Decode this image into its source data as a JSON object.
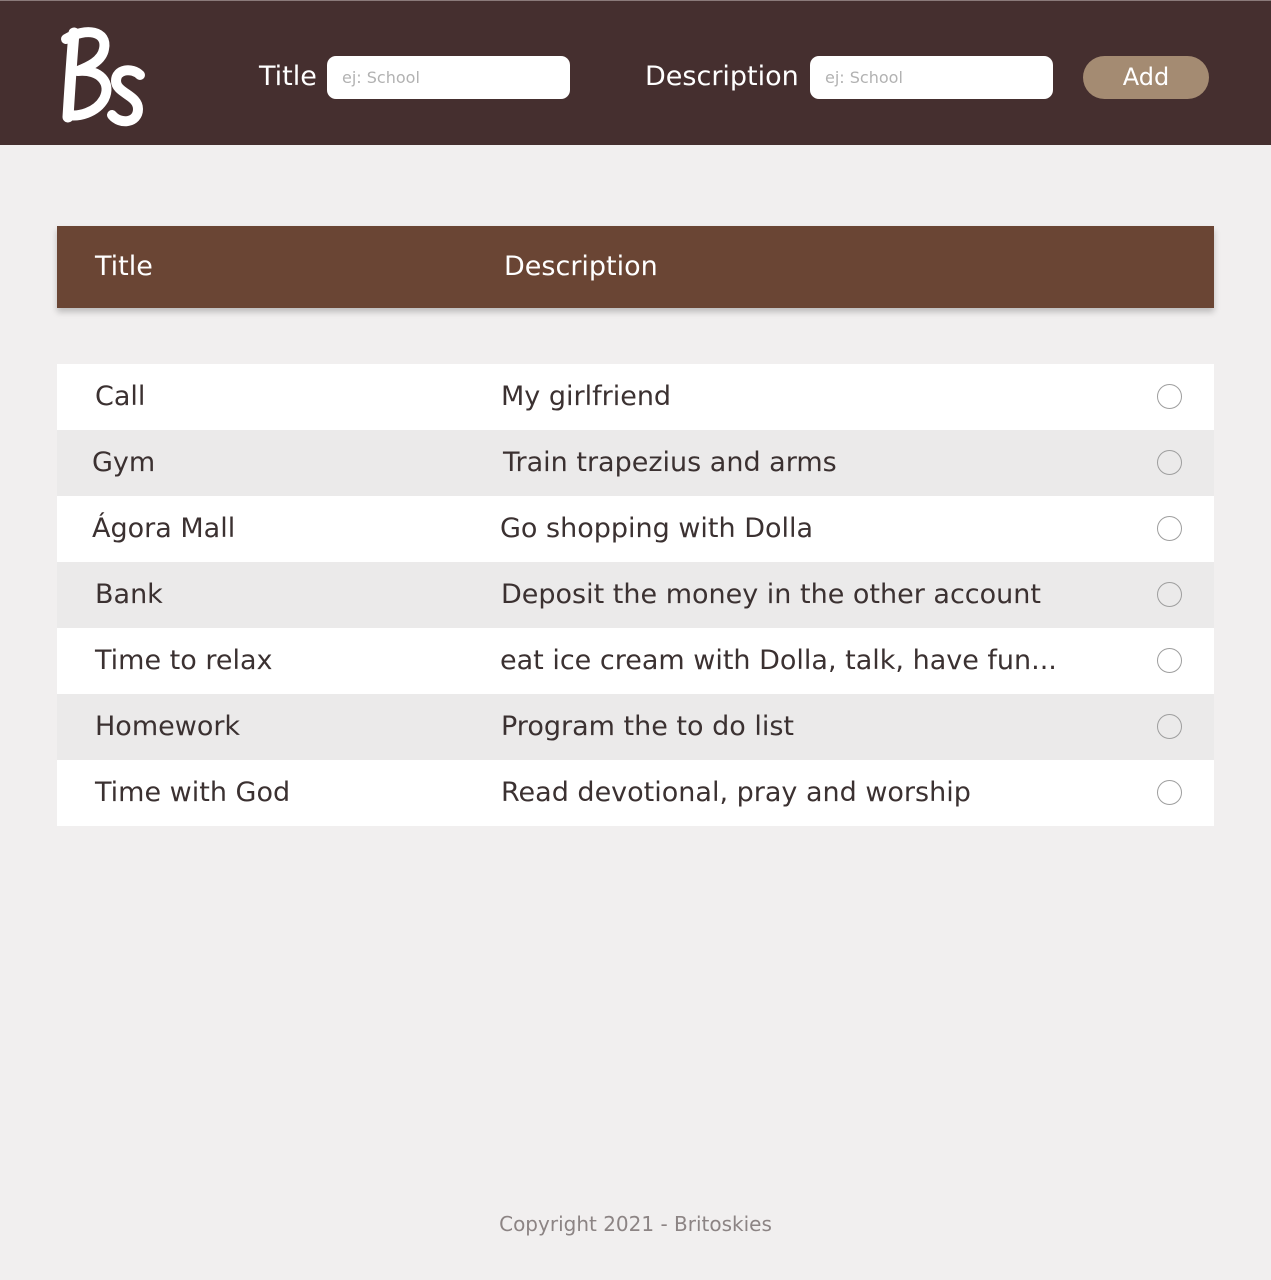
{
  "header": {
    "logo_text": "Bs",
    "title_label": "Title",
    "title_placeholder": "ej: School",
    "description_label": "Description",
    "description_placeholder": "ej: School",
    "add_label": "Add"
  },
  "table": {
    "headers": {
      "title": "Title",
      "description": "Description"
    },
    "rows": [
      {
        "title": "Call",
        "description": "My girlfriend",
        "done": false
      },
      {
        "title": "Gym",
        "description": "Train trapezius and arms",
        "done": false
      },
      {
        "title": "Ágora Mall",
        "description": "Go shopping with Dolla",
        "done": false
      },
      {
        "title": "Bank",
        "description": "Deposit the money in the other account",
        "done": false
      },
      {
        "title": "Time to relax",
        "description": "eat ice cream with Dolla, talk, have fun...",
        "done": false
      },
      {
        "title": "Homework",
        "description": "Program the to do list",
        "done": false
      },
      {
        "title": "Time with God",
        "description": "Read devotional, pray and worship",
        "done": false
      }
    ]
  },
  "footer": {
    "copyright": "Copyright 2021 - Britoskies"
  },
  "colors": {
    "header_bg": "#452f2f",
    "table_header_bg": "#6a4534",
    "accent": "#a48b72",
    "page_bg": "#f1efef"
  }
}
